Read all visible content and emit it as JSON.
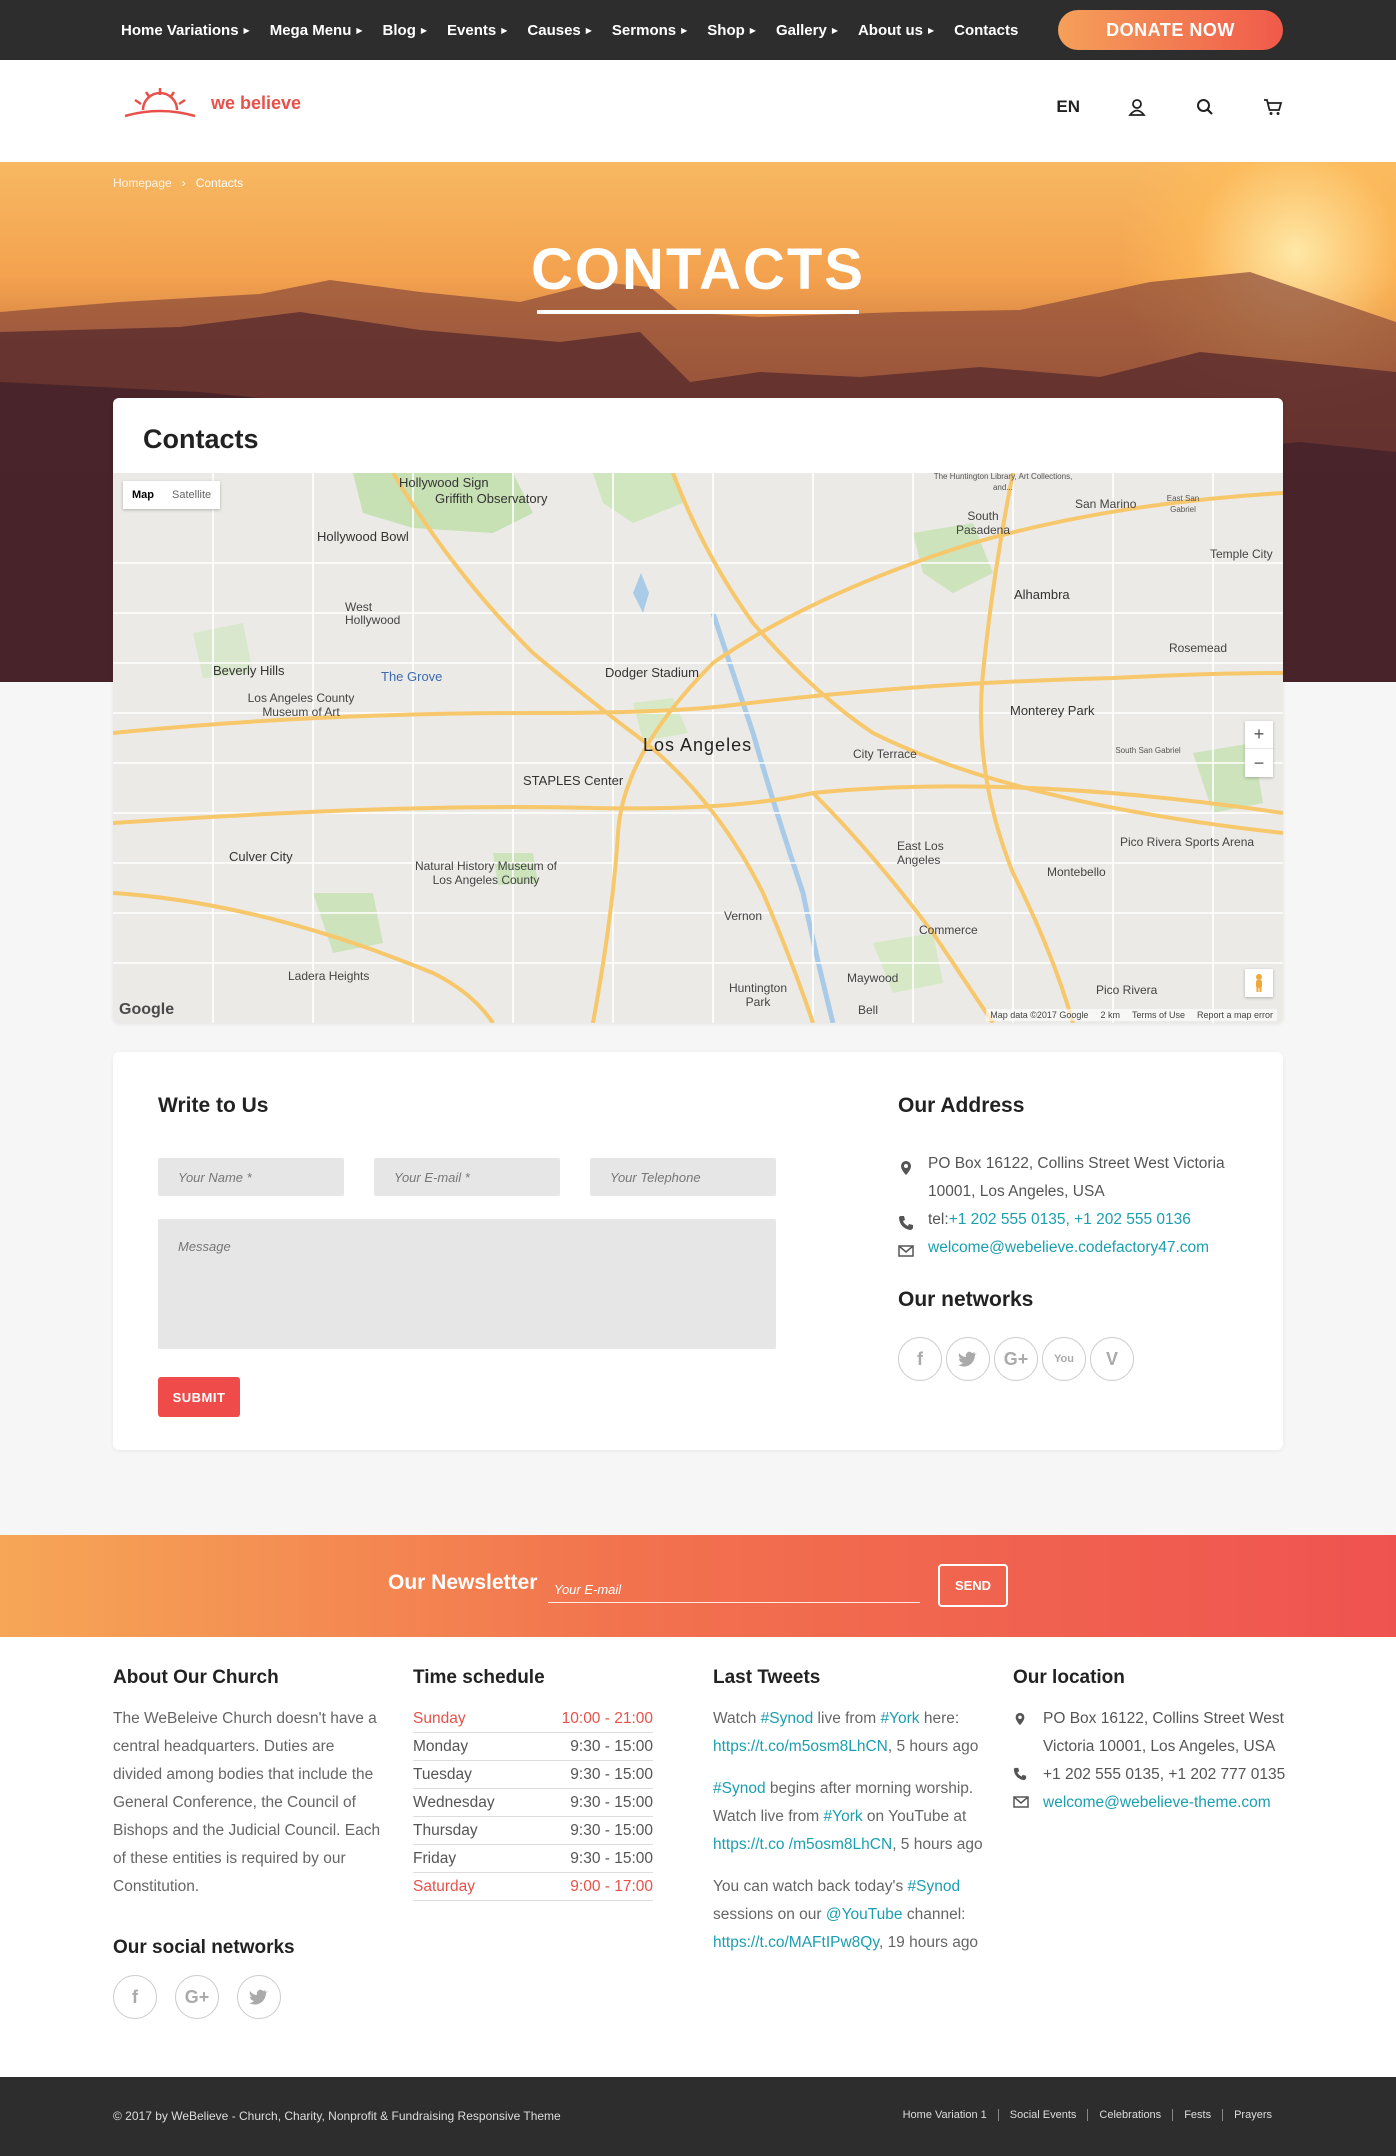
{
  "nav": {
    "items": [
      {
        "label": "Home Variations",
        "caret": true
      },
      {
        "label": "Mega Menu",
        "caret": true
      },
      {
        "label": "Blog",
        "caret": true
      },
      {
        "label": "Events",
        "caret": true
      },
      {
        "label": "Causes",
        "caret": true
      },
      {
        "label": "Sermons",
        "caret": true
      },
      {
        "label": "Shop",
        "caret": true
      },
      {
        "label": "Gallery",
        "caret": true
      },
      {
        "label": "About us",
        "caret": true
      },
      {
        "label": "Contacts",
        "caret": false
      }
    ],
    "donate_label": "DONATE NOW"
  },
  "header": {
    "logo_text": "we believe",
    "lang": "EN",
    "icons": [
      "user-icon",
      "search-icon",
      "cart-icon"
    ]
  },
  "hero": {
    "breadcrumb_home": "Homepage",
    "breadcrumb_sep": "›",
    "breadcrumb_current": "Contacts",
    "title": "CONTACTS"
  },
  "contacts": {
    "title": "Contacts",
    "map": {
      "toggle_map": "Map",
      "toggle_satellite": "Satellite",
      "zoom_in": "+",
      "zoom_out": "−",
      "google": "Google",
      "footer": [
        "Map data ©2017 Google",
        "2 km",
        "Terms of Use",
        "Report a map error"
      ],
      "labels": {
        "hollywood_sign": "Hollywood Sign",
        "griffith": "Griffith Observatory",
        "hollywood_bowl": "Hollywood Bowl",
        "west_hollywood": "West Hollywood",
        "beverly_hills": "Beverly Hills",
        "the_grove": "The Grove",
        "lacma": "Los Angeles County Museum of Art",
        "dodger": "Dodger Stadium",
        "los_angeles": "Los Angeles",
        "staples": "STAPLES Center",
        "culver_city": "Culver City",
        "nhm": "Natural History Museum of Los Angeles County",
        "ladera": "Ladera Heights",
        "huntington_park": "Huntington Park",
        "vernon": "Vernon",
        "commerce": "Commerce",
        "maywood": "Maywood",
        "bell": "Bell",
        "east_la": "East Los Angeles",
        "montebello": "Montebello",
        "pico_rivera": "Pico Rivera",
        "pico_arena": "Pico Rivera Sports Arena",
        "monterey_park": "Monterey Park",
        "alhambra": "Alhambra",
        "south_pasadena": "South Pasadena",
        "san_marino": "San Marino",
        "east_san_gabriel": "East San Gabriel",
        "temple_city": "Temple City",
        "rosemead": "Rosemead",
        "city_terrace": "City Terrace",
        "south_san_gabriel": "South San Gabriel",
        "huntington_library": "The Huntington Library, Art Collections, and..."
      }
    }
  },
  "write": {
    "title": "Write to Us",
    "name_placeholder": "Your Name *",
    "email_placeholder": "Your E-mail *",
    "phone_placeholder": "Your Telephone",
    "message_placeholder": "Message",
    "submit": "SUBMIT"
  },
  "address": {
    "title": "Our Address",
    "po": "PO Box 16122, Collins Street West Victoria 10001, Los Angeles, USA",
    "tel_prefix": "tel:",
    "tel": "+1 202 555 0135, +1 202 555 0136",
    "email": "welcome@webelieve.codefactory47.com",
    "networks_title": "Our networks",
    "networks": [
      "facebook-icon",
      "twitter-icon",
      "google-plus-icon",
      "youtube-icon",
      "vimeo-icon"
    ]
  },
  "newsletter": {
    "title": "Our Newsletter",
    "placeholder": "Your E-mail",
    "send": "SEND"
  },
  "footer": {
    "about_title": "About Our Church",
    "about_text": "The WeBeleive Church doesn't have a central headquarters. Duties are divided among bodies that include the General Conference, the Council of Bishops and the Judicial Council. Each of these entities is required by our Constitution.",
    "social_title": "Our social networks",
    "schedule_title": "Time schedule",
    "schedule": [
      {
        "day": "Sunday",
        "time": "10:00 - 21:00",
        "highlight": true
      },
      {
        "day": "Monday",
        "time": "9:30 - 15:00",
        "highlight": false
      },
      {
        "day": "Tuesday",
        "time": "9:30 - 15:00",
        "highlight": false
      },
      {
        "day": "Wednesday",
        "time": "9:30 - 15:00",
        "highlight": false
      },
      {
        "day": "Thursday",
        "time": "9:30 - 15:00",
        "highlight": false
      },
      {
        "day": "Friday",
        "time": "9:30 - 15:00",
        "highlight": false
      },
      {
        "day": "Saturday",
        "time": "9:00 - 17:00",
        "highlight": true
      }
    ],
    "tweets_title": "Last Tweets",
    "tweets": {
      "t1_a": "Watch ",
      "t1_tag1": "#Synod",
      "t1_b": " live from ",
      "t1_tag2": "#York",
      "t1_c": " here: ",
      "t1_link": "https://t.co/m5osm8LhCN",
      "t1_d": ", 5 hours ago",
      "t2_tag1": "#Synod",
      "t2_a": " begins after morning worship. Watch live from ",
      "t2_tag2": "#York",
      "t2_b": " on YouTube at ",
      "t2_link": "https://t.co /m5osm8LhCN",
      "t2_c": ", 5 hours ago",
      "t3_a": "You can watch back today's ",
      "t3_tag1": "#Synod",
      "t3_b": " sessions on our ",
      "t3_tag2": "@YouTube",
      "t3_c": " channel: ",
      "t3_link": "https://t.co/MAFtIPw8Qy",
      "t3_d": ", 19 hours ago"
    },
    "location_title": "Our location",
    "location_po": "PO Box 16122, Collins Street West Victoria 10001, Los Angeles, USA",
    "location_tel": "+1 202 555 0135, +1 202 777 0135",
    "location_email": "welcome@webelieve-theme.com",
    "copyright": "© 2017 by WeBelieve - Church, Charity, Nonprofit & Fundraising Responsive Theme",
    "bottom_links": [
      "Home Variation 1",
      "Social Events",
      "Celebrations",
      "Fests",
      "Prayers"
    ]
  },
  "colors": {
    "accent": "#ef4b4b",
    "link": "#1a9fb0",
    "dark": "#2d2d2d"
  }
}
